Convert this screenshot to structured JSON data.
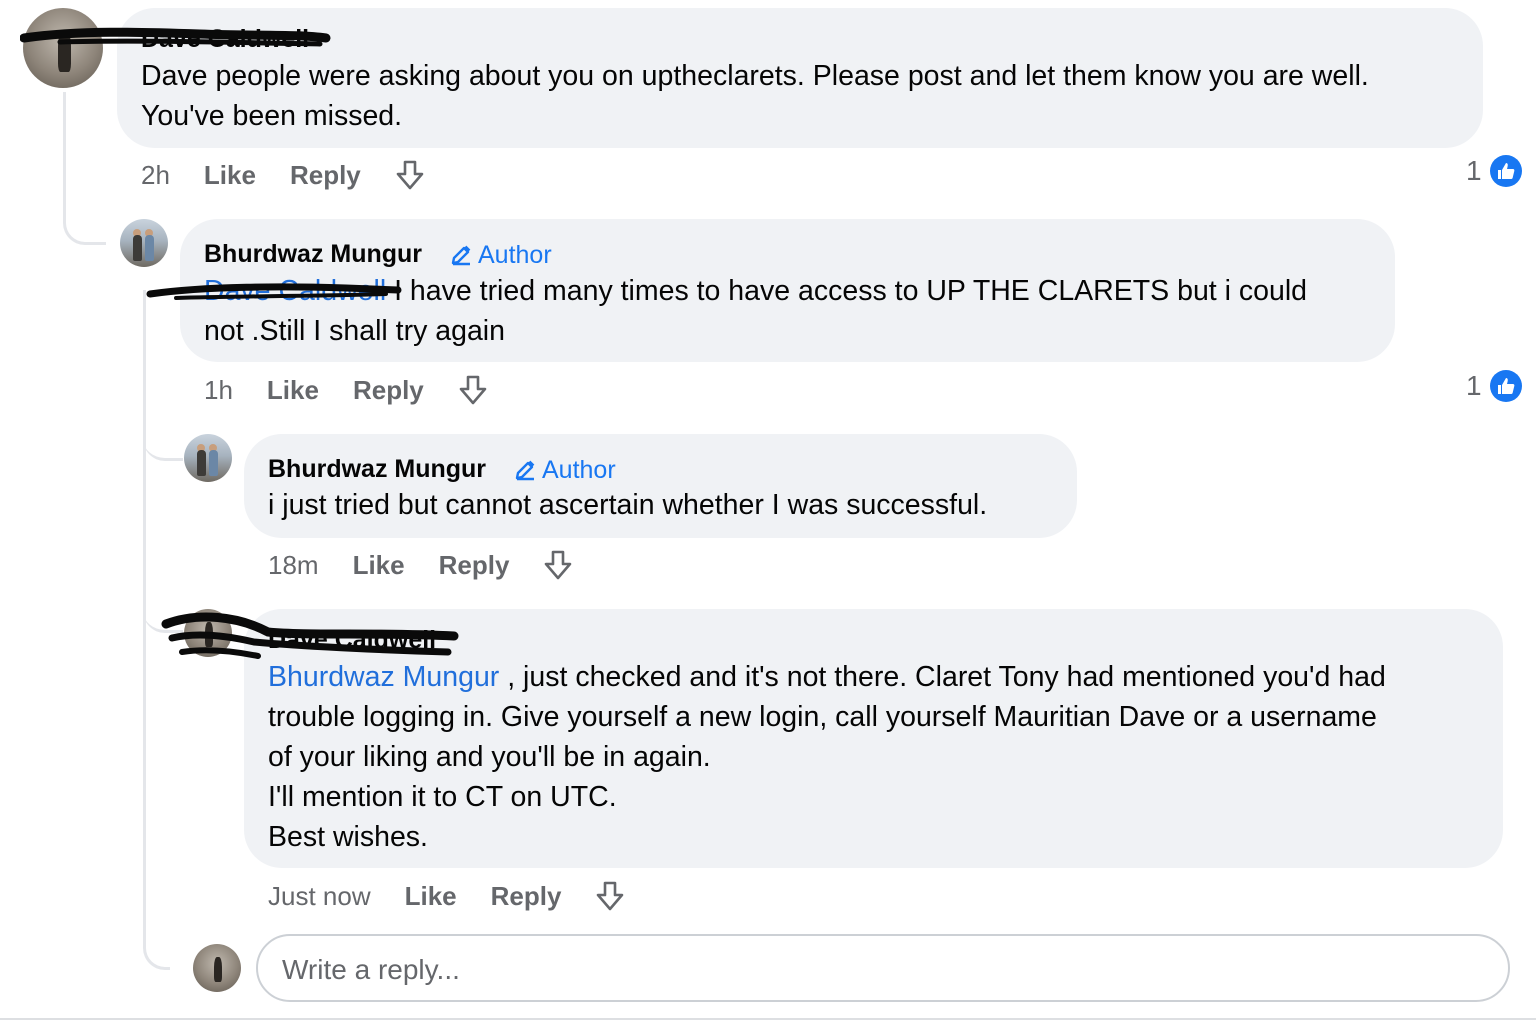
{
  "comments": [
    {
      "author": "Dave Caldwell",
      "is_author": false,
      "text": "Dave people were asking about you on uptheclarets. Please post and let them know you are well.\nYou've been missed.",
      "time": "2h",
      "like_label": "Like",
      "reply_label": "Reply",
      "reaction_count": "1"
    },
    {
      "author": "Bhurdwaz Mungur",
      "is_author": true,
      "author_badge": "Author",
      "mention": "Dave Caldwell",
      "text": " I have tried many times to have access to UP THE CLARETS but i could\nnot .Still I shall try again",
      "time": "1h",
      "like_label": "Like",
      "reply_label": "Reply",
      "reaction_count": "1"
    },
    {
      "author": "Bhurdwaz Mungur",
      "is_author": true,
      "author_badge": "Author",
      "text": "i just tried but cannot ascertain whether I was successful.",
      "time": "18m",
      "like_label": "Like",
      "reply_label": "Reply"
    },
    {
      "author": "Dave Caldwell",
      "is_author": false,
      "mention": "Bhurdwaz Mungur",
      "text": " , just checked and it's not there. Claret Tony had mentioned you'd had\ntrouble logging in. Give yourself a new login, call yourself Mauritian Dave or a username\nof your liking and you'll be in again.\nI'll mention it to CT on UTC.\nBest wishes.",
      "time": "Just now",
      "like_label": "Like",
      "reply_label": "Reply"
    }
  ],
  "reply_input": {
    "placeholder": "Write a reply..."
  },
  "colors": {
    "bubble": "#f0f2f5",
    "link": "#1877f2",
    "meta": "#65676b",
    "thread_line": "#e4e6ea"
  }
}
